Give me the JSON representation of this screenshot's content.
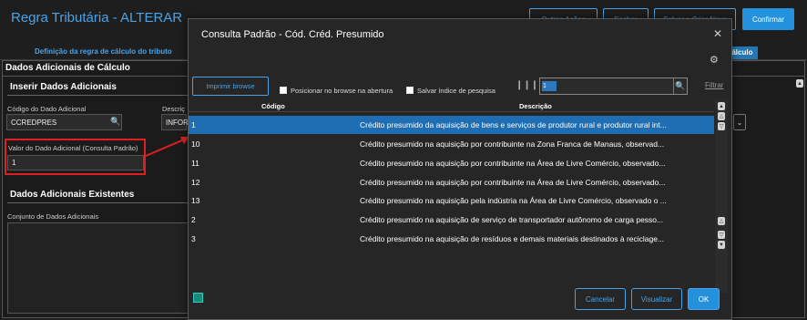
{
  "page": {
    "title": "Regra Tributária - ALTERAR",
    "header_buttons": [
      "Outras Ações",
      "Fechar",
      "Salvar e Criar Novo",
      "Confirmar"
    ],
    "tab_left": "Definição da regra de cálculo do tributo",
    "tab_right": "de Cálculo",
    "panel_title": "Dados Adicionais de Cálculo",
    "section_insert": "Inserir Dados Adicionais",
    "codigo_label": "Código do Dado Adicional",
    "codigo_value": "CCREDPRES",
    "descricao_label": "Descriç",
    "descricao_value": "INFOR",
    "valor_label": "Valor do Dado Adicional (Consulta Padrão)",
    "valor_value": "1",
    "section_existing": "Dados Adicionais Existentes",
    "conjunto_label": "Conjunto de Dados Adicionais"
  },
  "modal": {
    "title": "Consulta Padrão - Cód. Créd. Presumido",
    "close_icon": "close-icon",
    "print_button": "Imprimir browse",
    "position_checkbox": "Posicionar no browse na abertura",
    "save_index_checkbox": "Salvar índice de pesquisa",
    "search_value": "1",
    "filter_link": "Filtrar",
    "col_codigo": "Código",
    "col_descricao": "Descrição",
    "rows": [
      {
        "code": "1",
        "desc": "Crédito presumido da aquisição de bens e serviços de produtor rural e produtor rural int..."
      },
      {
        "code": "10",
        "desc": "Crédito presumido na aquisição por contribuinte na Zona Franca de Manaus, observad..."
      },
      {
        "code": "11",
        "desc": "Crédito presumido na aquisição por contribuinte na Área de Livre Comércio, observado..."
      },
      {
        "code": "12",
        "desc": "Crédito presumido na aquisição por contribuinte na Área de Livre Comércio, observado..."
      },
      {
        "code": "13",
        "desc": "Crédito presumido na aquisição pela indústria na Área de Livre Comércio, observado o ..."
      },
      {
        "code": "2",
        "desc": "Crédito presumido na aquisição de serviço de transportador autônomo de carga pesso..."
      },
      {
        "code": "3",
        "desc": "Crédito presumido na aquisição de resíduos e demais materiais destinados à reciclage..."
      }
    ],
    "cancel_button": "Cancelar",
    "view_button": "Visualizar",
    "ok_button": "OK"
  },
  "colors": {
    "accent": "#2491dd",
    "selected_row": "#1f6db3",
    "highlight_border": "#e02020"
  }
}
